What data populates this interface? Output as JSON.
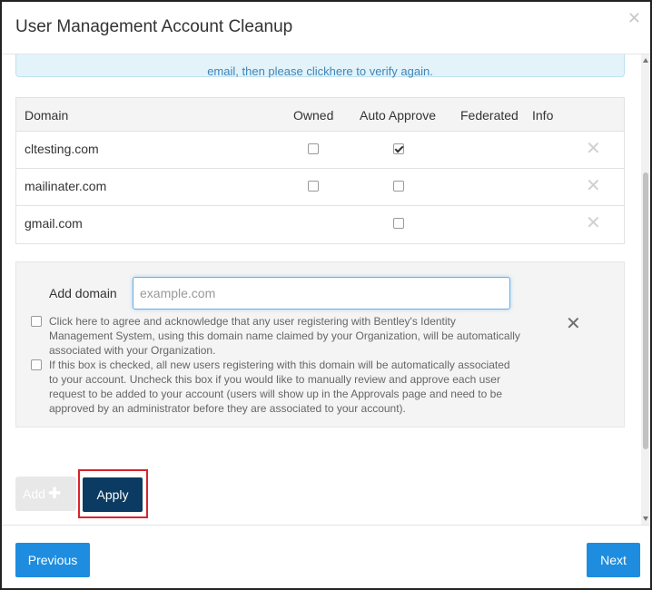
{
  "dialog": {
    "title": "User Management Account Cleanup",
    "close_icon": "close-icon"
  },
  "info": {
    "text_before": "email, then please click",
    "link": "here",
    "text_after": " to verify again."
  },
  "table": {
    "headers": {
      "domain": "Domain",
      "owned": "Owned",
      "auto_approve": "Auto Approve",
      "federated": "Federated",
      "info": "Info"
    },
    "rows": [
      {
        "domain": "cltesting.com",
        "owned": false,
        "auto_approve": true
      },
      {
        "domain": "mailinater.com",
        "owned": false,
        "auto_approve": false
      },
      {
        "domain": "gmail.com",
        "owned": null,
        "auto_approve": false
      }
    ],
    "remove_icon": "close-icon"
  },
  "add_domain": {
    "label": "Add domain",
    "placeholder": "example.com",
    "owned_text": "Click here to agree and acknowledge that any user registering with Bentley's Identity Management System, using this domain name claimed by your Organization, will be automatically associated with your Organization.",
    "auto_approve_text": "If this box is checked, all new users registering with this domain will be automatically associated to your account. Uncheck this box if you would like to manually review and approve each user request to be added to your account (users will show up in the Approvals page and need to be approved by an administrator before they are associated to your account).",
    "remove_icon": "close-icon"
  },
  "actions": {
    "add_label": "Add",
    "add_icon": "plus-icon",
    "apply_label": "Apply",
    "highlight_color": "#d9232e"
  },
  "footer": {
    "previous_label": "Previous",
    "next_label": "Next"
  },
  "colors": {
    "primary": "#1e8ddf",
    "apply": "#0b3b62",
    "info_bg": "#e3f3fa",
    "info_text": "#3f85b8"
  }
}
